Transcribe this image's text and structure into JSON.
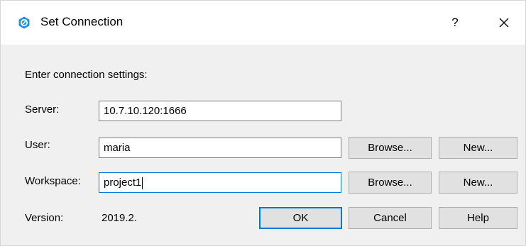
{
  "window": {
    "title": "Set Connection",
    "help_label": "?",
    "close_label": "Close"
  },
  "form": {
    "prompt": "Enter connection settings:",
    "server_label": "Server:",
    "server_value": "10.7.10.120:1666",
    "user_label": "User:",
    "user_value": "maria",
    "workspace_label": "Workspace:",
    "workspace_value": "project1",
    "version_label": "Version:",
    "version_value": "2019.2."
  },
  "buttons": {
    "browse_user": "Browse...",
    "new_user": "New...",
    "browse_workspace": "Browse...",
    "new_workspace": "New...",
    "ok": "OK",
    "cancel": "Cancel",
    "help": "Help"
  },
  "colors": {
    "accent": "#0078d7",
    "icon": "#1e90d6",
    "dialog_bg": "#f0f0f0",
    "button_bg": "#e1e1e1"
  }
}
